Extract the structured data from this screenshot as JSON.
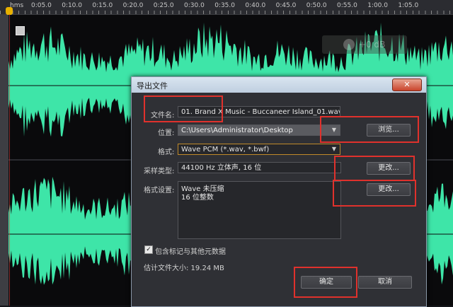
{
  "ruler": {
    "unit_label": "hms",
    "ticks": [
      "0:05.0",
      "0:10.0",
      "0:15.0",
      "0:20.0",
      "0:25.0",
      "0:30.0",
      "0:35.0",
      "0:40.0",
      "0:45.0",
      "0:50.0",
      "0:55.0",
      "1:00.0",
      "1:05.0"
    ]
  },
  "hud": {
    "value": "+0 dB"
  },
  "colors": {
    "waveform": "#3ee5a8",
    "background": "#0a0a0c",
    "highlight": "#e0312c"
  },
  "dialog": {
    "title": "导出文件",
    "close_label": "✕",
    "filename_label": "文件名:",
    "filename_value": "01. Brand X Music - Buccaneer Island_01.wav",
    "location_label": "位置:",
    "location_value": "C:\\Users\\Administrator\\Desktop",
    "browse_label": "浏览...",
    "format_label": "格式:",
    "format_value": "Wave PCM (*.wav, *.bwf)",
    "sample_type_label": "采样类型:",
    "sample_type_value": "44100 Hz 立体声, 16 位",
    "change_label": "更改...",
    "format_settings_label": "格式设置:",
    "format_settings_lines": [
      "Wave 未压缩",
      "16 位整数"
    ],
    "include_markers_label": "包含标记与其他元数据",
    "estimated_size_label": "估计文件大小: 19.24 MB",
    "ok_label": "确定",
    "cancel_label": "取消"
  }
}
